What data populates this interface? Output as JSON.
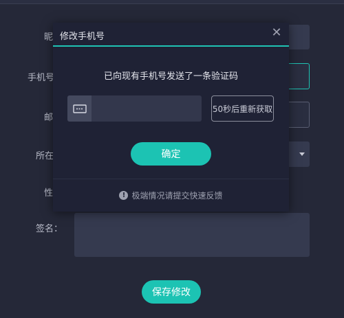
{
  "form": {
    "nickname_label": "昵",
    "phone_label": "手机号",
    "email_label": "邮",
    "location_label": "所在",
    "gender_label": "性",
    "signature_label": "签名：",
    "save_button": "保存修改"
  },
  "modal": {
    "title": "修改手机号",
    "close_glyph": "✕",
    "message": "已向现有手机号发送了一条验证码",
    "code_input_value": "",
    "code_input_placeholder": "",
    "resend_button": "50秒后重新获取",
    "confirm_button": "确定",
    "info_glyph": "!",
    "feedback_text": "极端情况请提交快速反馈"
  },
  "colors": {
    "accent": "#1cc3b3",
    "background": "#252838",
    "modal_bg": "#1f2235"
  },
  "icons": {
    "code_icon": "verification-code-icon",
    "close_icon": "close-icon",
    "info_icon": "info-icon",
    "select_arrow": "chevron-down-icon"
  }
}
